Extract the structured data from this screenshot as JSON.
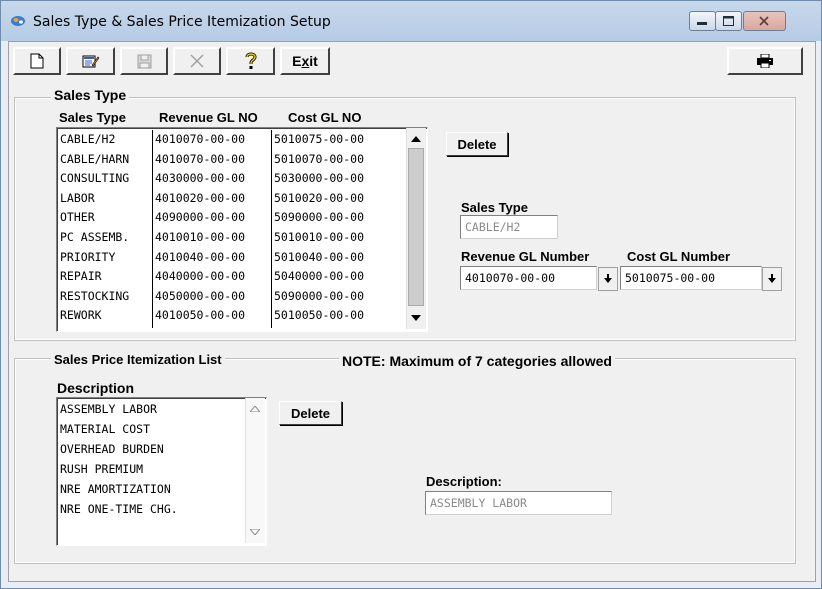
{
  "window": {
    "title": "Sales Type & Sales Price Itemization Setup"
  },
  "toolbar": {
    "exit_label": "Exit"
  },
  "sales_type": {
    "group_label": "Sales Type",
    "columns": [
      "Sales Type",
      "Revenue GL NO",
      "Cost GL NO"
    ],
    "rows": [
      [
        "CABLE/H2",
        "4010070-00-00",
        "5010075-00-00"
      ],
      [
        "CABLE/HARN",
        "4010070-00-00",
        "5010070-00-00"
      ],
      [
        "CONSULTING",
        "4030000-00-00",
        "5030000-00-00"
      ],
      [
        "LABOR",
        "4010020-00-00",
        "5010020-00-00"
      ],
      [
        "OTHER",
        "4090000-00-00",
        "5090000-00-00"
      ],
      [
        "PC ASSEMB.",
        "4010010-00-00",
        "5010010-00-00"
      ],
      [
        "PRIORITY",
        "4010040-00-00",
        "5010040-00-00"
      ],
      [
        "REPAIR",
        "4040000-00-00",
        "5040000-00-00"
      ],
      [
        "RESTOCKING",
        "4050000-00-00",
        "5090000-00-00"
      ],
      [
        "REWORK",
        "4010050-00-00",
        "5010050-00-00"
      ]
    ],
    "delete_label": "Delete",
    "sales_type_label": "Sales Type",
    "sales_type_value": "CABLE/H2",
    "revenue_gl_label": "Revenue GL Number",
    "revenue_gl_value": "4010070-00-00",
    "cost_gl_label": "Cost GL Number",
    "cost_gl_value": "5010075-00-00"
  },
  "itemization": {
    "group_label": "Sales Price Itemization List",
    "note": "NOTE: Maximum of 7 categories allowed",
    "description_header": "Description",
    "items": [
      "ASSEMBLY LABOR",
      "MATERIAL COST",
      "OVERHEAD BURDEN",
      "RUSH PREMIUM",
      "NRE AMORTIZATION",
      "NRE ONE-TIME CHG."
    ],
    "delete_label": "Delete",
    "description_label": "Description:",
    "description_value": "ASSEMBLY LABOR"
  },
  "icons": {
    "app": "app-icon",
    "new": "new-document-icon",
    "edit": "edit-icon",
    "save": "save-icon",
    "cancel": "cancel-icon",
    "help": "help-icon",
    "print": "printer-icon"
  }
}
